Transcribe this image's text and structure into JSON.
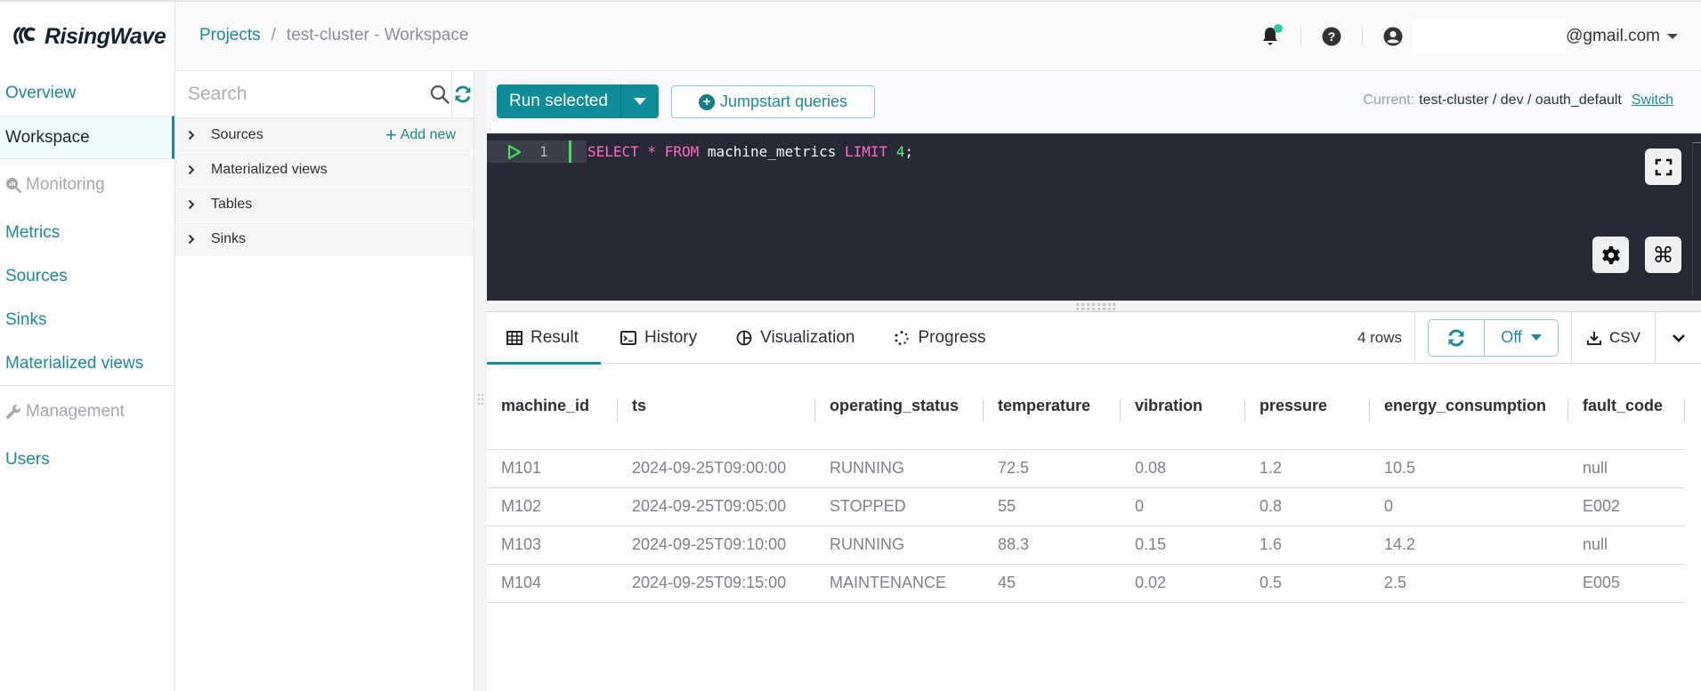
{
  "brand": {
    "name": "RisingWave"
  },
  "header": {
    "breadcrumb": {
      "root": "Projects",
      "separator": "/",
      "current": "test-cluster - Workspace"
    },
    "user_email": "@gmail.com"
  },
  "leftnav": {
    "items": [
      {
        "label": "Overview"
      },
      {
        "label": "Workspace"
      }
    ],
    "monitoring_label": "Monitoring",
    "monitoring_items": [
      {
        "label": "Metrics"
      },
      {
        "label": "Sources"
      },
      {
        "label": "Sinks"
      },
      {
        "label": "Materialized views"
      }
    ],
    "management_label": "Management",
    "management_items": [
      {
        "label": "Users"
      }
    ]
  },
  "schema_panel": {
    "search_placeholder": "Search",
    "add_new_label": "Add new",
    "tree": [
      {
        "label": "Sources"
      },
      {
        "label": "Materialized views"
      },
      {
        "label": "Tables"
      },
      {
        "label": "Sinks"
      }
    ]
  },
  "toolbar": {
    "run_label": "Run selected",
    "jumpstart_label": "Jumpstart queries",
    "context_label": "Current:",
    "context_value": "test-cluster / dev / oauth_default",
    "switch_label": "Switch"
  },
  "editor": {
    "line_number": "1",
    "code": {
      "kw_select": "SELECT",
      "star": " * ",
      "kw_from": "FROM",
      "table": " machine_metrics ",
      "kw_limit": "LIMIT",
      "space": " ",
      "limit_value": "4",
      "terminator": ";"
    }
  },
  "results": {
    "tabs": [
      {
        "label": "Result"
      },
      {
        "label": "History"
      },
      {
        "label": "Visualization"
      },
      {
        "label": "Progress"
      }
    ],
    "row_count": "4 rows",
    "refresh_interval": "Off",
    "csv_label": "CSV",
    "columns": [
      "machine_id",
      "ts",
      "operating_status",
      "temperature",
      "vibration",
      "pressure",
      "energy_consumption",
      "fault_code"
    ],
    "rows": [
      [
        "M101",
        "2024-09-25T09:00:00",
        "RUNNING",
        "72.5",
        "0.08",
        "1.2",
        "10.5",
        "null"
      ],
      [
        "M102",
        "2024-09-25T09:05:00",
        "STOPPED",
        "55",
        "0",
        "0.8",
        "0",
        "E002"
      ],
      [
        "M103",
        "2024-09-25T09:10:00",
        "RUNNING",
        "88.3",
        "0.15",
        "1.6",
        "14.2",
        "null"
      ],
      [
        "M104",
        "2024-09-25T09:15:00",
        "MAINTENANCE",
        "45",
        "0.02",
        "0.5",
        "2.5",
        "E005"
      ]
    ]
  }
}
